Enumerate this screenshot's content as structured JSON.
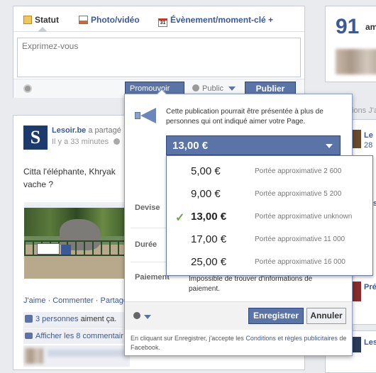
{
  "composer": {
    "tabs": [
      {
        "label": "Statut"
      },
      {
        "label": "Photo/vidéo"
      },
      {
        "label": "Évènement/moment-clé +"
      }
    ],
    "placeholder": "Exprimez-vous",
    "promote_label": "Promouvoir",
    "audience_label": "Public",
    "publish_label": "Publier"
  },
  "post": {
    "author": "Lesoir.be",
    "action": "a partagé",
    "time": "Il y a 33 minutes",
    "text": "Citta l'éléphante, Khryak vache ?",
    "like_label": "J'aime",
    "comment_label": "Commenter",
    "share_label": "Partage",
    "likes_prefix": "3 personnes",
    "likes_suffix": "aiment ça.",
    "show_comments": "Afficher les 8 commentair"
  },
  "right": {
    "count": "91",
    "count_suffix": "am",
    "side_snippet": "ions J'a",
    "names": [
      "Le",
      "28",
      "Les",
      "Pré"
    ],
    "bottom_name": "Les"
  },
  "promo": {
    "info_text": "Cette publication pourrait être présentée à plus de personnes qui ont indiqué aimer votre Page.",
    "selected": "13,00 €",
    "options": [
      {
        "amount": "5,00 €",
        "reach": "Portée approximative 2 600",
        "selected": false
      },
      {
        "amount": "9,00 €",
        "reach": "Portée approximative 5 200",
        "selected": false
      },
      {
        "amount": "13,00 €",
        "reach": "Portée approximative unknown",
        "selected": true
      },
      {
        "amount": "17,00 €",
        "reach": "Portée approximative 11 000",
        "selected": false
      },
      {
        "amount": "25,00 €",
        "reach": "Portée approximative 16 000",
        "selected": false
      }
    ],
    "devise_label": "Devise",
    "duree_label": "Durée",
    "paiement_label": "Paiement",
    "payment_text": "Impossible de trouver d'informations de paiement.",
    "save_label": "Enregistrer",
    "cancel_label": "Annuler",
    "legal_prefix": "En cliquant sur Enregistrer, j'accepte les",
    "legal_link": "Conditions et règles publicitaires",
    "legal_suffix": "de Facebook.",
    "accent": "#3b5998",
    "check_color": "#6aa84f"
  }
}
